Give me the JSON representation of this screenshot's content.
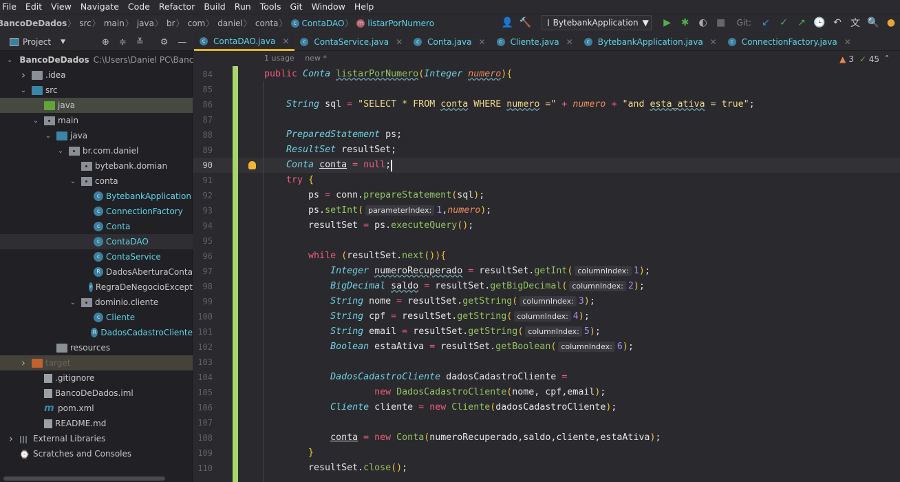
{
  "menu": [
    "File",
    "Edit",
    "View",
    "Navigate",
    "Code",
    "Refactor",
    "Build",
    "Run",
    "Tools",
    "Git",
    "Window",
    "Help"
  ],
  "breadcrumb": [
    {
      "label": "BancoDeDados",
      "bold": true
    },
    {
      "label": "src"
    },
    {
      "label": "main"
    },
    {
      "label": "java"
    },
    {
      "label": "br"
    },
    {
      "label": "com"
    },
    {
      "label": "daniel"
    },
    {
      "label": "conta"
    },
    {
      "label": "ContaDAO",
      "icon": "class"
    },
    {
      "label": "listarPorNumero",
      "icon": "method"
    }
  ],
  "toolbar": {
    "run_config": "BytebankApplication",
    "git_label": "Git:"
  },
  "project_panel": {
    "title": "Project"
  },
  "tabs": [
    {
      "label": "ContaDAO.java",
      "active": true
    },
    {
      "label": "ContaService.java"
    },
    {
      "label": "Conta.java"
    },
    {
      "label": "Cliente.java"
    },
    {
      "label": "BytebankApplication.java",
      "icon": "run-class"
    },
    {
      "label": "ConnectionFactory.java"
    }
  ],
  "tree": [
    {
      "depth": 0,
      "chev": "down",
      "icon": "module",
      "label": "BancoDeDados",
      "bold": true,
      "path": "C:\\Users\\Daniel PC\\BancoD"
    },
    {
      "depth": 1,
      "chev": "right",
      "icon": "folder",
      "label": ".idea"
    },
    {
      "depth": 1,
      "chev": "down",
      "icon": "folder-src",
      "label": "src"
    },
    {
      "depth": 2,
      "icon": "folder-test",
      "label": "java",
      "state": "selected"
    },
    {
      "depth": 2,
      "chev": "down",
      "icon": "package",
      "label": "main"
    },
    {
      "depth": 3,
      "chev": "down",
      "icon": "folder-src",
      "label": "java"
    },
    {
      "depth": 4,
      "chev": "down",
      "icon": "package",
      "label": "br.com.daniel"
    },
    {
      "depth": 5,
      "icon": "package",
      "label": "bytebank.domian"
    },
    {
      "depth": 5,
      "chev": "down",
      "icon": "package",
      "label": "conta"
    },
    {
      "depth": 6,
      "icon": "class-run",
      "label": "BytebankApplication",
      "cyan": true
    },
    {
      "depth": 6,
      "icon": "class",
      "label": "ConnectionFactory",
      "cyan": true
    },
    {
      "depth": 6,
      "icon": "class",
      "label": "Conta",
      "cyan": true
    },
    {
      "depth": 6,
      "icon": "class",
      "label": "ContaDAO",
      "cyan": true,
      "state": "current"
    },
    {
      "depth": 6,
      "icon": "class",
      "label": "ContaService",
      "cyan": true
    },
    {
      "depth": 6,
      "icon": "record",
      "label": "DadosAberturaConta"
    },
    {
      "depth": 6,
      "icon": "exception",
      "label": "RegraDeNegocioExcept"
    },
    {
      "depth": 5,
      "chev": "down",
      "icon": "package",
      "label": "dominio.cliente"
    },
    {
      "depth": 6,
      "icon": "class",
      "label": "Cliente",
      "cyan": true
    },
    {
      "depth": 6,
      "icon": "record",
      "label": "DadosCadastroCliente",
      "cyan": true
    },
    {
      "depth": 3,
      "icon": "folder-res",
      "label": "resources"
    },
    {
      "depth": 1,
      "chev": "right",
      "icon": "folder-excluded",
      "label": "target",
      "state": "excluded"
    },
    {
      "depth": 2,
      "icon": "file-gitignore",
      "label": ".gitignore"
    },
    {
      "depth": 2,
      "icon": "file-iml",
      "label": "BancoDeDados.iml"
    },
    {
      "depth": 2,
      "icon": "maven",
      "label": "pom.xml"
    },
    {
      "depth": 2,
      "icon": "markdown",
      "label": "README.md"
    },
    {
      "depth": 0,
      "chev": "right",
      "icon": "libraries",
      "label": "External Libraries"
    },
    {
      "depth": 0,
      "icon": "scratches",
      "label": "Scratches and Consoles"
    }
  ],
  "editor": {
    "usage_hint": [
      "1 usage",
      "new *"
    ],
    "warnings": "3",
    "weak_warnings": "45",
    "current_line": 90,
    "lines": [
      {
        "n": 84,
        "tokens": [
          [
            "k",
            "public "
          ],
          [
            "t",
            "Conta "
          ],
          [
            "f w",
            "listarPorNumero"
          ],
          [
            "b",
            "("
          ],
          [
            "t",
            "Integer "
          ],
          [
            "p w",
            "numero"
          ],
          [
            "b",
            ")"
          ],
          [
            "b",
            "{"
          ]
        ]
      },
      {
        "n": 85,
        "tokens": []
      },
      {
        "n": 86,
        "tokens": [
          [
            "",
            "    "
          ],
          [
            "t",
            "String "
          ],
          [
            "",
            "sql "
          ],
          [
            "o",
            "= "
          ],
          [
            "s",
            "\"SELECT * FROM "
          ],
          [
            "s w",
            "conta"
          ],
          [
            "s",
            " WHERE "
          ],
          [
            "s w",
            "numero"
          ],
          [
            "s",
            " =\" "
          ],
          [
            "o",
            "+ "
          ],
          [
            "p",
            "numero "
          ],
          [
            "o",
            "+ "
          ],
          [
            "s",
            "\"and "
          ],
          [
            "s w",
            "esta_ativa"
          ],
          [
            "s",
            " = true\""
          ],
          [
            "",
            ";"
          ]
        ]
      },
      {
        "n": 87,
        "tokens": []
      },
      {
        "n": 88,
        "tokens": [
          [
            "",
            "    "
          ],
          [
            "t",
            "PreparedStatement "
          ],
          [
            "",
            "ps;"
          ]
        ]
      },
      {
        "n": 89,
        "tokens": [
          [
            "",
            "    "
          ],
          [
            "t",
            "ResultSet "
          ],
          [
            "",
            "resultSet;"
          ]
        ]
      },
      {
        "n": 90,
        "tokens": [
          [
            "",
            "    "
          ],
          [
            "t",
            "Conta "
          ],
          [
            "u",
            "conta"
          ],
          [
            "",
            " "
          ],
          [
            "o",
            "= "
          ],
          [
            "k",
            "null"
          ],
          [
            "",
            ";"
          ]
        ]
      },
      {
        "n": 91,
        "tokens": [
          [
            "",
            "    "
          ],
          [
            "k",
            "try "
          ],
          [
            "b",
            "{"
          ]
        ]
      },
      {
        "n": 92,
        "tokens": [
          [
            "",
            "        ps "
          ],
          [
            "o",
            "= "
          ],
          [
            "",
            "conn."
          ],
          [
            "f",
            "prepareStatement"
          ],
          [
            "b",
            "("
          ],
          [
            "",
            "sql"
          ],
          [
            "b",
            ")"
          ],
          [
            "",
            ";"
          ]
        ]
      },
      {
        "n": 93,
        "tokens": [
          [
            "",
            "        ps."
          ],
          [
            "f",
            "setInt"
          ],
          [
            "b",
            "("
          ],
          [
            "h",
            "parameterIndex:"
          ],
          [
            "n",
            "1"
          ],
          [
            "",
            ","
          ],
          [
            "p",
            "numero"
          ],
          [
            "b",
            ")"
          ],
          [
            "",
            ";"
          ]
        ]
      },
      {
        "n": 94,
        "tokens": [
          [
            "",
            "        resultSet "
          ],
          [
            "o",
            "= "
          ],
          [
            "",
            "ps."
          ],
          [
            "f",
            "executeQuery"
          ],
          [
            "b",
            "()"
          ],
          [
            "",
            ";"
          ]
        ]
      },
      {
        "n": 95,
        "tokens": []
      },
      {
        "n": 96,
        "tokens": [
          [
            "",
            "        "
          ],
          [
            "k",
            "while "
          ],
          [
            "b",
            "("
          ],
          [
            "",
            "resultSet."
          ],
          [
            "f",
            "next"
          ],
          [
            "b",
            "()"
          ],
          [
            "b",
            ")"
          ],
          [
            "b",
            "{"
          ]
        ]
      },
      {
        "n": 97,
        "tokens": [
          [
            "",
            "            "
          ],
          [
            "t",
            "Integer "
          ],
          [
            "w",
            "numeroRecuperado"
          ],
          [
            "",
            " "
          ],
          [
            "o",
            "= "
          ],
          [
            "",
            "resultSet."
          ],
          [
            "f",
            "getInt"
          ],
          [
            "b",
            "("
          ],
          [
            "h",
            "columnIndex:"
          ],
          [
            "n",
            "1"
          ],
          [
            "b",
            ")"
          ],
          [
            "",
            ";"
          ]
        ]
      },
      {
        "n": 98,
        "tokens": [
          [
            "",
            "            "
          ],
          [
            "t",
            "BigDecimal "
          ],
          [
            "w",
            "saldo"
          ],
          [
            "",
            " "
          ],
          [
            "o",
            "= "
          ],
          [
            "",
            "resultSet."
          ],
          [
            "f",
            "getBigDecimal"
          ],
          [
            "b",
            "("
          ],
          [
            "h",
            "columnIndex:"
          ],
          [
            "n",
            "2"
          ],
          [
            "b",
            ")"
          ],
          [
            "",
            ";"
          ]
        ]
      },
      {
        "n": 99,
        "tokens": [
          [
            "",
            "            "
          ],
          [
            "t",
            "String "
          ],
          [
            "",
            "nome "
          ],
          [
            "o",
            "= "
          ],
          [
            "",
            "resultSet."
          ],
          [
            "f",
            "getString"
          ],
          [
            "b",
            "("
          ],
          [
            "h",
            "columnIndex:"
          ],
          [
            "n",
            "3"
          ],
          [
            "b",
            ")"
          ],
          [
            "",
            ";"
          ]
        ]
      },
      {
        "n": 100,
        "tokens": [
          [
            "",
            "            "
          ],
          [
            "t",
            "String "
          ],
          [
            "",
            "cpf "
          ],
          [
            "o",
            "= "
          ],
          [
            "",
            "resultSet."
          ],
          [
            "f",
            "getString"
          ],
          [
            "b",
            "("
          ],
          [
            "h",
            "columnIndex:"
          ],
          [
            "n",
            "4"
          ],
          [
            "b",
            ")"
          ],
          [
            "",
            ";"
          ]
        ]
      },
      {
        "n": 101,
        "tokens": [
          [
            "",
            "            "
          ],
          [
            "t",
            "String "
          ],
          [
            "",
            "email "
          ],
          [
            "o",
            "= "
          ],
          [
            "",
            "resultSet."
          ],
          [
            "f",
            "getString"
          ],
          [
            "b",
            "("
          ],
          [
            "h",
            "columnIndex:"
          ],
          [
            "n",
            "5"
          ],
          [
            "b",
            ")"
          ],
          [
            "",
            ";"
          ]
        ]
      },
      {
        "n": 102,
        "tokens": [
          [
            "",
            "            "
          ],
          [
            "t",
            "Boolean "
          ],
          [
            "",
            "estaAtiva "
          ],
          [
            "o",
            "= "
          ],
          [
            "",
            "resultSet."
          ],
          [
            "f",
            "getBoolean"
          ],
          [
            "b",
            "("
          ],
          [
            "h",
            "columnIndex:"
          ],
          [
            "n",
            "6"
          ],
          [
            "b",
            ")"
          ],
          [
            "",
            ";"
          ]
        ]
      },
      {
        "n": 103,
        "tokens": []
      },
      {
        "n": 104,
        "tokens": [
          [
            "",
            "            "
          ],
          [
            "t",
            "DadosCadastroCliente "
          ],
          [
            "",
            "dadosCadastroCliente "
          ],
          [
            "o",
            "="
          ]
        ]
      },
      {
        "n": 105,
        "tokens": [
          [
            "",
            "                    "
          ],
          [
            "k",
            "new "
          ],
          [
            "f",
            "DadosCadastroCliente"
          ],
          [
            "b",
            "("
          ],
          [
            "",
            "nome, cpf,email"
          ],
          [
            "b",
            ")"
          ],
          [
            "",
            ";"
          ]
        ]
      },
      {
        "n": 106,
        "tokens": [
          [
            "",
            "            "
          ],
          [
            "t",
            "Cliente "
          ],
          [
            "",
            "cliente "
          ],
          [
            "o",
            "= "
          ],
          [
            "k",
            "new "
          ],
          [
            "f",
            "Cliente"
          ],
          [
            "b",
            "("
          ],
          [
            "",
            "dadosCadastroCliente"
          ],
          [
            "b",
            ")"
          ],
          [
            "",
            ";"
          ]
        ]
      },
      {
        "n": 107,
        "tokens": []
      },
      {
        "n": 108,
        "tokens": [
          [
            "",
            "            "
          ],
          [
            "u",
            "conta"
          ],
          [
            "",
            " "
          ],
          [
            "o",
            "= "
          ],
          [
            "k",
            "new "
          ],
          [
            "f",
            "Conta"
          ],
          [
            "b",
            "("
          ],
          [
            "",
            "numeroRecuperado,saldo,cliente,estaAtiva"
          ],
          [
            "b",
            ")"
          ],
          [
            "",
            ";"
          ]
        ]
      },
      {
        "n": 109,
        "tokens": [
          [
            "",
            "        "
          ],
          [
            "b",
            "}"
          ]
        ]
      },
      {
        "n": 110,
        "tokens": [
          [
            "",
            "        resultSet."
          ],
          [
            "f",
            "close"
          ],
          [
            "b",
            "()"
          ],
          [
            "",
            ";"
          ]
        ]
      }
    ]
  },
  "colors": {
    "accent_tab": "#e6b422",
    "keyword": "#ee5d7a",
    "type": "#6fd2e3",
    "method": "#93c361",
    "string": "#f0d98c",
    "change_bar": "#a8d56e"
  }
}
